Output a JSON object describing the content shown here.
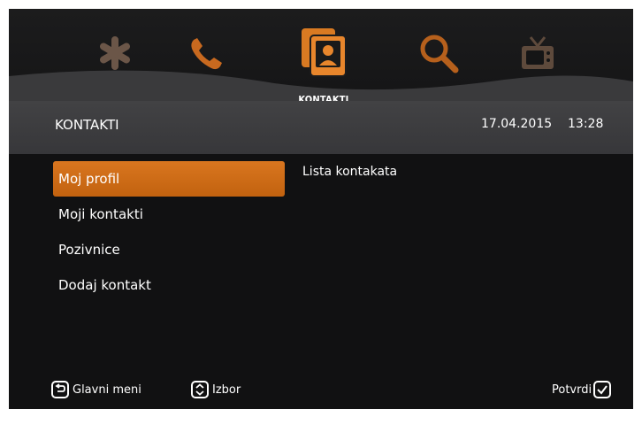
{
  "top_nav": {
    "icons": [
      "settings-icon",
      "phone-icon",
      "contacts-icon",
      "search-icon",
      "tv-icon"
    ],
    "active_label": "KONTAKTI"
  },
  "title_bar": {
    "title": "KONTAKTI",
    "date": "17.04.2015",
    "time": "13:28"
  },
  "menu": {
    "items": [
      {
        "label": "Moj profil",
        "selected": true
      },
      {
        "label": "Moji kontakti",
        "selected": false
      },
      {
        "label": "Pozivnice",
        "selected": false
      },
      {
        "label": "Dodaj kontakt",
        "selected": false
      }
    ]
  },
  "content": {
    "title": "Lista kontakata"
  },
  "footer": {
    "back_label": "Glavni meni",
    "select_label": "Izbor",
    "confirm_label": "Potvrdi"
  },
  "colors": {
    "accent_orange": "#d0691a",
    "background": "#111112",
    "title_bar": "#3c3c3e"
  }
}
